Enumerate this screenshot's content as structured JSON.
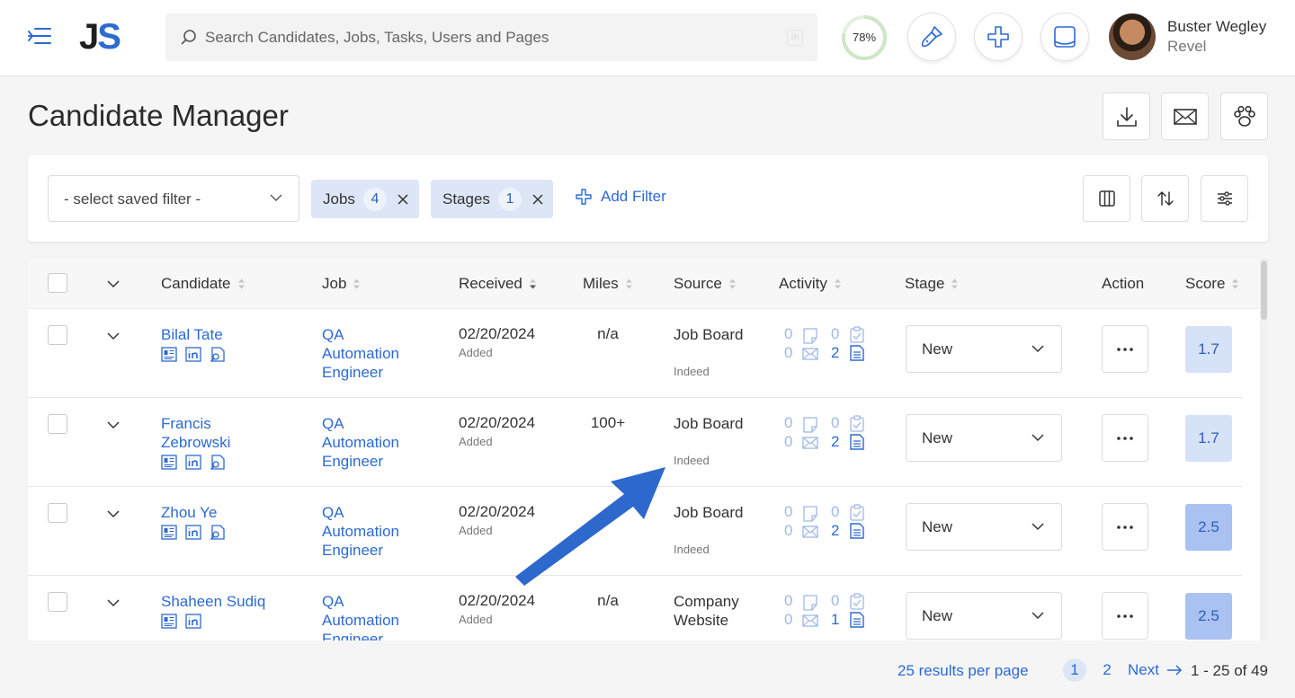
{
  "header": {
    "logo_j": "J",
    "logo_s": "S",
    "search_placeholder": "Search Candidates, Jobs, Tasks, Users and Pages",
    "linkedin_label": "in",
    "progress_text": "78%",
    "progress_value": 0.78,
    "user_name": "Buster Wegley",
    "user_org": "Revel"
  },
  "page": {
    "title": "Candidate Manager"
  },
  "filters": {
    "saved_filter": "- select saved filter -",
    "chips": [
      {
        "label": "Jobs",
        "count": "4"
      },
      {
        "label": "Stages",
        "count": "1"
      }
    ],
    "add_filter": "Add Filter"
  },
  "table": {
    "columns": {
      "candidate": "Candidate",
      "job": "Job",
      "received": "Received",
      "miles": "Miles",
      "source": "Source",
      "activity": "Activity",
      "stage": "Stage",
      "action": "Action",
      "score": "Score"
    },
    "rows": [
      {
        "name": "Bilal Tate",
        "job": "QA Automation Engineer",
        "date": "02/20/2024",
        "date_note": "Added",
        "miles": "n/a",
        "source": "Job Board",
        "source_sub": "Indeed",
        "notes": "0",
        "tasks": "0",
        "emails": "0",
        "docs": "2",
        "stage": "New",
        "score": "1.7"
      },
      {
        "name": "Francis Zebrowski",
        "job": "QA Automation Engineer",
        "date": "02/20/2024",
        "date_note": "Added",
        "miles": "100+",
        "source": "Job Board",
        "source_sub": "Indeed",
        "notes": "0",
        "tasks": "0",
        "emails": "0",
        "docs": "2",
        "stage": "New",
        "score": "1.7"
      },
      {
        "name": "Zhou Ye",
        "job": "QA Automation Engineer",
        "date": "02/20/2024",
        "date_note": "Added",
        "miles": "+",
        "source": "Job Board",
        "source_sub": "Indeed",
        "notes": "0",
        "tasks": "0",
        "emails": "0",
        "docs": "2",
        "stage": "New",
        "score": "2.5"
      },
      {
        "name": "Shaheen Sudiq",
        "job": "QA Automation Engineer",
        "date": "02/20/2024",
        "date_note": "Added",
        "miles": "n/a",
        "source": "Company Website",
        "source_sub": "",
        "notes": "0",
        "tasks": "0",
        "emails": "0",
        "docs": "1",
        "stage": "New",
        "score": "2.5"
      }
    ]
  },
  "pagination": {
    "per_page": "25 results per page",
    "pages": [
      "1",
      "2"
    ],
    "next": "Next",
    "range": "1 - 25 of 49"
  },
  "colors": {
    "accent": "#2d6ad1",
    "chip_bg": "#dde6f6",
    "score_low": "#d6e2f8",
    "score_mid": "#a9c2f1",
    "annotation_arrow": "#2d68cc"
  },
  "icons": {
    "menu": "menu-collapse-icon",
    "search": "search-icon",
    "brush": "paintbrush-icon",
    "plus": "plus-icon",
    "inbox": "inbox-icon",
    "download": "download-icon",
    "mail": "mail-icon",
    "paw": "paw-icon",
    "columns": "columns-icon",
    "sort": "sort-icon",
    "settings": "sliders-icon"
  }
}
